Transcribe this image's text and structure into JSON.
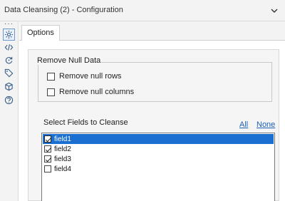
{
  "window": {
    "title": "Data Cleansing (2) - Configuration"
  },
  "sidebar": {
    "items": [
      {
        "icon": "gear-icon",
        "active": true
      },
      {
        "icon": "code-icon",
        "active": false
      },
      {
        "icon": "refresh-icon",
        "active": false
      },
      {
        "icon": "tag-icon",
        "active": false
      },
      {
        "icon": "cube-icon",
        "active": false
      },
      {
        "icon": "help-icon",
        "active": false
      }
    ]
  },
  "tabs": [
    {
      "label": "Options",
      "active": true
    }
  ],
  "null_data": {
    "legend": "Remove Null Data",
    "options": [
      {
        "label": "Remove null rows",
        "checked": false
      },
      {
        "label": "Remove null columns",
        "checked": false
      }
    ]
  },
  "fields": {
    "label": "Select Fields to Cleanse",
    "all_link": "All",
    "none_link": "None",
    "items": [
      {
        "label": "field1",
        "checked": true,
        "selected": true
      },
      {
        "label": "field2",
        "checked": true,
        "selected": false
      },
      {
        "label": "field3",
        "checked": true,
        "selected": false
      },
      {
        "label": "field4",
        "checked": false,
        "selected": false
      }
    ]
  },
  "colors": {
    "selection": "#1b6fd1",
    "link": "#1a5fb4",
    "icon": "#3a5f8a"
  }
}
